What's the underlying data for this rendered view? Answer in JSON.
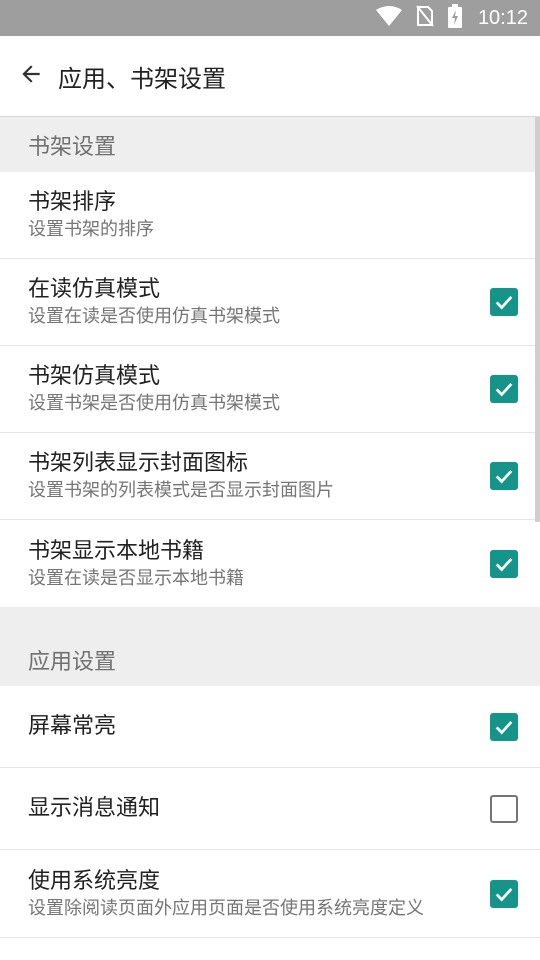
{
  "status_bar": {
    "time": "10:12",
    "icons": [
      "wifi-icon",
      "no-sim-icon",
      "battery-charging-icon"
    ]
  },
  "app_bar": {
    "back_icon": "arrow-back-icon",
    "title": "应用、书架设置"
  },
  "sections": [
    {
      "header": "书架设置",
      "items": [
        {
          "title": "书架排序",
          "summary": "设置书架的排序"
        },
        {
          "title": "在读仿真模式",
          "summary": "设置在读是否使用仿真书架模式",
          "checked": true
        },
        {
          "title": "书架仿真模式",
          "summary": "设置书架是否使用仿真书架模式",
          "checked": true
        },
        {
          "title": "书架列表显示封面图标",
          "summary": "设置书架的列表模式是否显示封面图片",
          "checked": true
        },
        {
          "title": "书架显示本地书籍",
          "summary": "设置在读是否显示本地书籍",
          "checked": true
        }
      ]
    },
    {
      "header": "应用设置",
      "items": [
        {
          "title": "屏幕常亮",
          "checked": true
        },
        {
          "title": "显示消息通知",
          "checked": false
        },
        {
          "title": "使用系统亮度",
          "summary": "设置除阅读页面外应用页面是否使用系统亮度定义",
          "checked": true
        }
      ]
    }
  ],
  "colors": {
    "accent": "#15958a",
    "status_bar": "#9e9e9e",
    "section_bg": "#eeeeee"
  }
}
